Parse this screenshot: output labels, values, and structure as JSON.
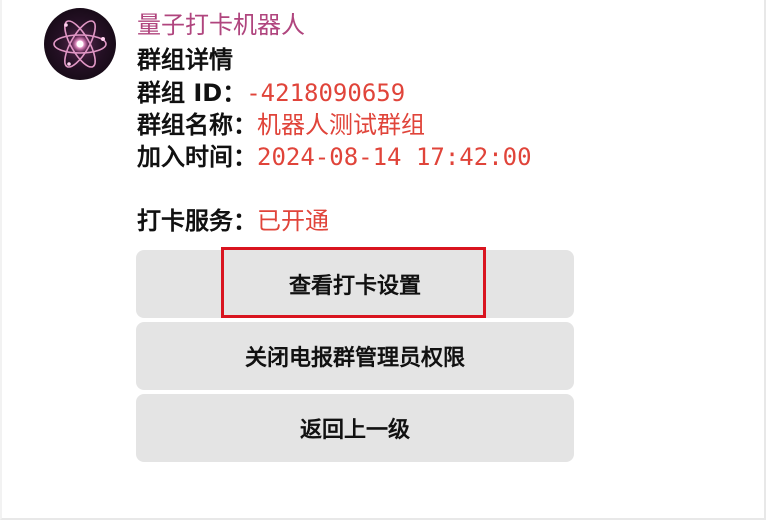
{
  "bot": {
    "name": "量子打卡机器人",
    "avatar_icon": "atom-icon"
  },
  "group": {
    "header": "群组详情",
    "id_label": "群组 ID：",
    "id_value": "-4218090659",
    "name_label": "群组名称：",
    "name_value": "机器人测试群组",
    "joined_label": "加入时间：",
    "joined_value": "2024-08-14 17:42:00",
    "service_label": "打卡服务：",
    "service_value": "已开通"
  },
  "buttons": [
    {
      "label": "查看打卡设置"
    },
    {
      "label": "关闭电报群管理员权限"
    },
    {
      "label": "返回上一级"
    }
  ],
  "colors": {
    "bot_name": "#b0457e",
    "value_text": "#e0443a",
    "button_bg": "#e4e4e4",
    "highlight_border": "#d9141f"
  }
}
